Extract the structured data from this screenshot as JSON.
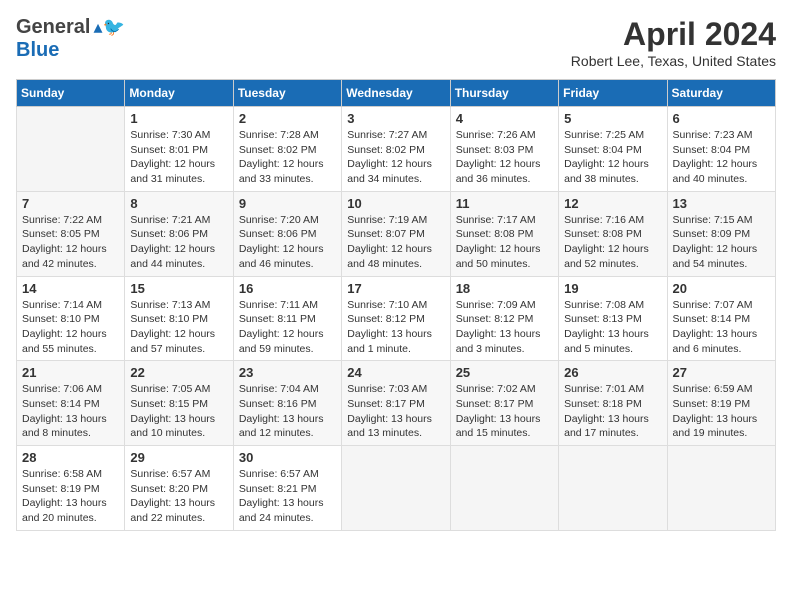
{
  "header": {
    "logo_general": "General",
    "logo_blue": "Blue",
    "title": "April 2024",
    "location": "Robert Lee, Texas, United States"
  },
  "days_of_week": [
    "Sunday",
    "Monday",
    "Tuesday",
    "Wednesday",
    "Thursday",
    "Friday",
    "Saturday"
  ],
  "weeks": [
    [
      {
        "num": "",
        "info": ""
      },
      {
        "num": "1",
        "info": "Sunrise: 7:30 AM\nSunset: 8:01 PM\nDaylight: 12 hours\nand 31 minutes."
      },
      {
        "num": "2",
        "info": "Sunrise: 7:28 AM\nSunset: 8:02 PM\nDaylight: 12 hours\nand 33 minutes."
      },
      {
        "num": "3",
        "info": "Sunrise: 7:27 AM\nSunset: 8:02 PM\nDaylight: 12 hours\nand 34 minutes."
      },
      {
        "num": "4",
        "info": "Sunrise: 7:26 AM\nSunset: 8:03 PM\nDaylight: 12 hours\nand 36 minutes."
      },
      {
        "num": "5",
        "info": "Sunrise: 7:25 AM\nSunset: 8:04 PM\nDaylight: 12 hours\nand 38 minutes."
      },
      {
        "num": "6",
        "info": "Sunrise: 7:23 AM\nSunset: 8:04 PM\nDaylight: 12 hours\nand 40 minutes."
      }
    ],
    [
      {
        "num": "7",
        "info": "Sunrise: 7:22 AM\nSunset: 8:05 PM\nDaylight: 12 hours\nand 42 minutes."
      },
      {
        "num": "8",
        "info": "Sunrise: 7:21 AM\nSunset: 8:06 PM\nDaylight: 12 hours\nand 44 minutes."
      },
      {
        "num": "9",
        "info": "Sunrise: 7:20 AM\nSunset: 8:06 PM\nDaylight: 12 hours\nand 46 minutes."
      },
      {
        "num": "10",
        "info": "Sunrise: 7:19 AM\nSunset: 8:07 PM\nDaylight: 12 hours\nand 48 minutes."
      },
      {
        "num": "11",
        "info": "Sunrise: 7:17 AM\nSunset: 8:08 PM\nDaylight: 12 hours\nand 50 minutes."
      },
      {
        "num": "12",
        "info": "Sunrise: 7:16 AM\nSunset: 8:08 PM\nDaylight: 12 hours\nand 52 minutes."
      },
      {
        "num": "13",
        "info": "Sunrise: 7:15 AM\nSunset: 8:09 PM\nDaylight: 12 hours\nand 54 minutes."
      }
    ],
    [
      {
        "num": "14",
        "info": "Sunrise: 7:14 AM\nSunset: 8:10 PM\nDaylight: 12 hours\nand 55 minutes."
      },
      {
        "num": "15",
        "info": "Sunrise: 7:13 AM\nSunset: 8:10 PM\nDaylight: 12 hours\nand 57 minutes."
      },
      {
        "num": "16",
        "info": "Sunrise: 7:11 AM\nSunset: 8:11 PM\nDaylight: 12 hours\nand 59 minutes."
      },
      {
        "num": "17",
        "info": "Sunrise: 7:10 AM\nSunset: 8:12 PM\nDaylight: 13 hours\nand 1 minute."
      },
      {
        "num": "18",
        "info": "Sunrise: 7:09 AM\nSunset: 8:12 PM\nDaylight: 13 hours\nand 3 minutes."
      },
      {
        "num": "19",
        "info": "Sunrise: 7:08 AM\nSunset: 8:13 PM\nDaylight: 13 hours\nand 5 minutes."
      },
      {
        "num": "20",
        "info": "Sunrise: 7:07 AM\nSunset: 8:14 PM\nDaylight: 13 hours\nand 6 minutes."
      }
    ],
    [
      {
        "num": "21",
        "info": "Sunrise: 7:06 AM\nSunset: 8:14 PM\nDaylight: 13 hours\nand 8 minutes."
      },
      {
        "num": "22",
        "info": "Sunrise: 7:05 AM\nSunset: 8:15 PM\nDaylight: 13 hours\nand 10 minutes."
      },
      {
        "num": "23",
        "info": "Sunrise: 7:04 AM\nSunset: 8:16 PM\nDaylight: 13 hours\nand 12 minutes."
      },
      {
        "num": "24",
        "info": "Sunrise: 7:03 AM\nSunset: 8:17 PM\nDaylight: 13 hours\nand 13 minutes."
      },
      {
        "num": "25",
        "info": "Sunrise: 7:02 AM\nSunset: 8:17 PM\nDaylight: 13 hours\nand 15 minutes."
      },
      {
        "num": "26",
        "info": "Sunrise: 7:01 AM\nSunset: 8:18 PM\nDaylight: 13 hours\nand 17 minutes."
      },
      {
        "num": "27",
        "info": "Sunrise: 6:59 AM\nSunset: 8:19 PM\nDaylight: 13 hours\nand 19 minutes."
      }
    ],
    [
      {
        "num": "28",
        "info": "Sunrise: 6:58 AM\nSunset: 8:19 PM\nDaylight: 13 hours\nand 20 minutes."
      },
      {
        "num": "29",
        "info": "Sunrise: 6:57 AM\nSunset: 8:20 PM\nDaylight: 13 hours\nand 22 minutes."
      },
      {
        "num": "30",
        "info": "Sunrise: 6:57 AM\nSunset: 8:21 PM\nDaylight: 13 hours\nand 24 minutes."
      },
      {
        "num": "",
        "info": ""
      },
      {
        "num": "",
        "info": ""
      },
      {
        "num": "",
        "info": ""
      },
      {
        "num": "",
        "info": ""
      }
    ]
  ]
}
